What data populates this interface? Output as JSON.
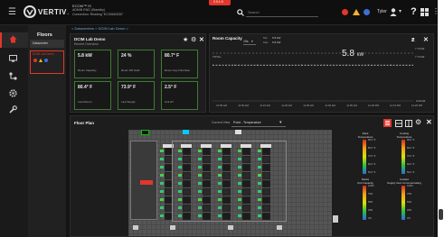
{
  "brand": {
    "name": "VERTIV",
    "tm": "."
  },
  "header": {
    "l1": "ECOM™ IS",
    "l2": "ADMIN ENG (Standby)",
    "l3": "Connection: Reading \"ECOM40330\"",
    "search_placeholder": "Search",
    "user": "Tyler",
    "dev": "2.9.1.5"
  },
  "nav": {
    "title": "Floors",
    "item": "Datacenter",
    "thumb_title": "DCIM Lab Demo"
  },
  "breadcrumb": "< Datacenters  >  DCIM Lab Demo  >",
  "lab": {
    "title": "DCIM Lab Demo",
    "subtitle": "Recent Overview",
    "tiles": [
      {
        "v": "5.8 kW",
        "l": "Room Capacity"
      },
      {
        "v": "24 %",
        "l": "Room kW Avail"
      },
      {
        "v": "80.7° F",
        "l": "Room Avg Cold Aisle"
      },
      {
        "v": "80.4° F",
        "l": "Last Return"
      },
      {
        "v": "73.9° F",
        "l": "Last Supply"
      },
      {
        "v": "2.5° F",
        "l": "Unit ΔT"
      }
    ]
  },
  "capacity": {
    "title": "Room Capacity",
    "range": "15s",
    "min_label": "Min",
    "min": "5.8 kW",
    "max_label": "Max",
    "max": "5.8 kW",
    "big": "5.8",
    "big_unit": "kW",
    "total": "TOTAL",
    "ytop": "7.73 kW",
    "ymid": "7.73 kW",
    "ybot": "0.00 kW",
    "times": [
      "10:55 AM",
      "11:05 AM",
      "11:15 AM",
      "11:25 AM",
      "11:35 AM",
      "11:45 AM",
      "11:55 AM",
      "12:05 PM",
      "12:15 PM",
      "12:25 PM"
    ]
  },
  "chart_data": {
    "type": "line",
    "series": [
      {
        "values": [
          5.8,
          5.8,
          5.8,
          5.8,
          5.8,
          5.8,
          5.8,
          5.8,
          5.8,
          5.8
        ]
      }
    ],
    "ylim": [
      0,
      7.73
    ]
  },
  "floor": {
    "title": "Floor Plan",
    "view_label": "Current View",
    "view_value": "Point - Temperature"
  },
  "legend": [
    {
      "title": "Rack\nTemperature",
      "ticks": [
        "90.0 °F",
        "80.0 °F",
        "70.0 °F",
        "60.0 °F",
        "50.0 °F"
      ]
    },
    {
      "title": "Cooling\nTemperature",
      "ticks": [
        "90.0 °F",
        "80.0 °F",
        "70.0 °F",
        "60.0 °F",
        "50.0 °F"
      ]
    },
    {
      "title": "Racks\nUnit Capacity",
      "ticks": [
        "100%",
        "75%",
        "50%",
        "25%",
        "0%"
      ]
    },
    {
      "title": "Coolant\nSupply Vent Communicating",
      "ticks": [
        "100%",
        "75%",
        "50%",
        "25%",
        "0%"
      ]
    }
  ],
  "colors": {
    "accent": "#e2372c",
    "green": "#3f7b32",
    "line": "#dcdcdc"
  }
}
